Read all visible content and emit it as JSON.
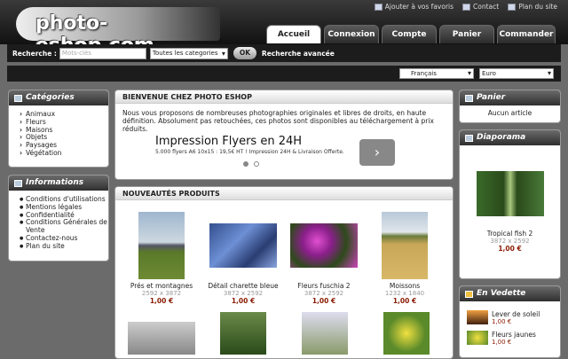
{
  "logo": "photo-eshop.com",
  "toplinks": [
    "Ajouter à vos favoris",
    "Contact",
    "Plan du site"
  ],
  "tabs": [
    "Accueil",
    "Connexion",
    "Compte",
    "Panier",
    "Commander"
  ],
  "search": {
    "label": "Recherche :",
    "placeholder": "Mots-clés",
    "category": "Toutes les categories",
    "ok": "OK",
    "advanced": "Recherche avancée"
  },
  "lang": "Français",
  "currency": "Euro",
  "categories": {
    "title": "Catégories",
    "items": [
      "Animaux",
      "Fleurs",
      "Maisons",
      "Objets",
      "Paysages",
      "Végétation"
    ]
  },
  "info": {
    "title": "Informations",
    "items": [
      "Conditions d'utilisations",
      "Mentions légales",
      "Confidentialité",
      "Conditions Générales de Vente",
      "Contactez-nous",
      "Plan du site"
    ]
  },
  "welcome": {
    "title": "BIENVENUE CHEZ PHOTO ESHOP",
    "text": "Nous vous proposons de nombreuses photographies originales et libres de droits, en haute définition. Absolument pas retouchées, ces photos sont disponibles au téléchargement à prix réduits."
  },
  "ad": {
    "title": "Impression Flyers en 24H",
    "sub": "5.000 flyers A6 10x15 : 19,5€ HT ! Impression 24H & Livraison Offerte.",
    "btn": "›"
  },
  "news": {
    "title": "NOUVEAUTÉS PRODUITS",
    "items": [
      {
        "name": "Prés et montagnes",
        "dims": "2592 x 3872",
        "price": "1,00 €"
      },
      {
        "name": "Détail charette bleue",
        "dims": "3872 x 2592",
        "price": "1,00 €"
      },
      {
        "name": "Fleurs fuschia 2",
        "dims": "3872 x 2592",
        "price": "1,00 €"
      },
      {
        "name": "Moissons",
        "dims": "1232 x 1840",
        "price": "1,00 €"
      }
    ]
  },
  "cart": {
    "title": "Panier",
    "empty": "Aucun article"
  },
  "diaporama": {
    "title": "Diaporama",
    "name": "Tropical fish 2",
    "dims": "3872 x 2592",
    "price": "1,00 €"
  },
  "featured": {
    "title": "En Vedette",
    "items": [
      {
        "name": "Lever de soleil",
        "price": "1,00 €"
      },
      {
        "name": "Fleurs jaunes",
        "price": "1,00 €"
      }
    ]
  }
}
